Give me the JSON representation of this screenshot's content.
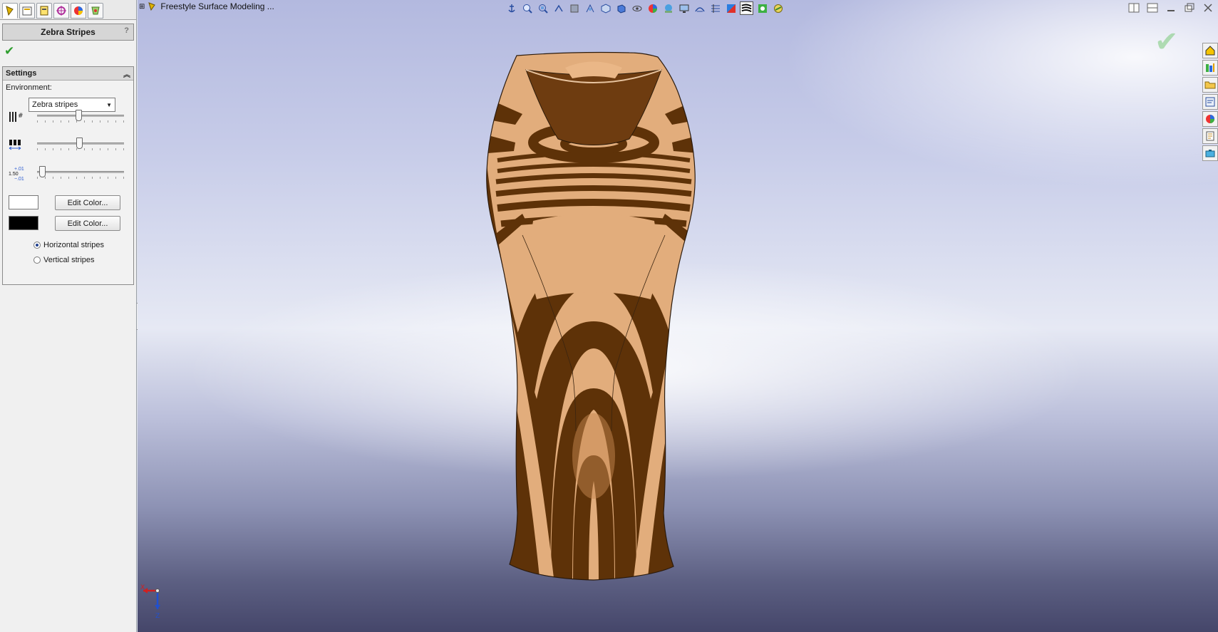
{
  "app": {
    "document_title": "Freestyle Surface Modeling ...",
    "property_manager": {
      "title": "Zebra Stripes",
      "help": "?",
      "settings": {
        "header": "Settings",
        "environment_label": "Environment:",
        "environment_value": "Zebra stripes",
        "sliders": [
          {
            "name": "number-of-stripes",
            "value": 0.48
          },
          {
            "name": "stripe-width",
            "value": 0.49
          },
          {
            "name": "precision",
            "value": 0.03
          }
        ],
        "precision_label": "1.50",
        "color1": {
          "swatch": "#ffffff",
          "button": "Edit Color..."
        },
        "color2": {
          "swatch": "#000000",
          "button": "Edit Color..."
        },
        "orientation": {
          "options": [
            "Horizontal stripes",
            "Vertical stripes"
          ],
          "selected": "Horizontal stripes"
        }
      }
    },
    "triad": {
      "x": "X",
      "z": "Z"
    },
    "colors": {
      "stripe_dark": "#5e3208",
      "stripe_light": "#e2ad7c",
      "accept": "#2e9e2e"
    }
  }
}
